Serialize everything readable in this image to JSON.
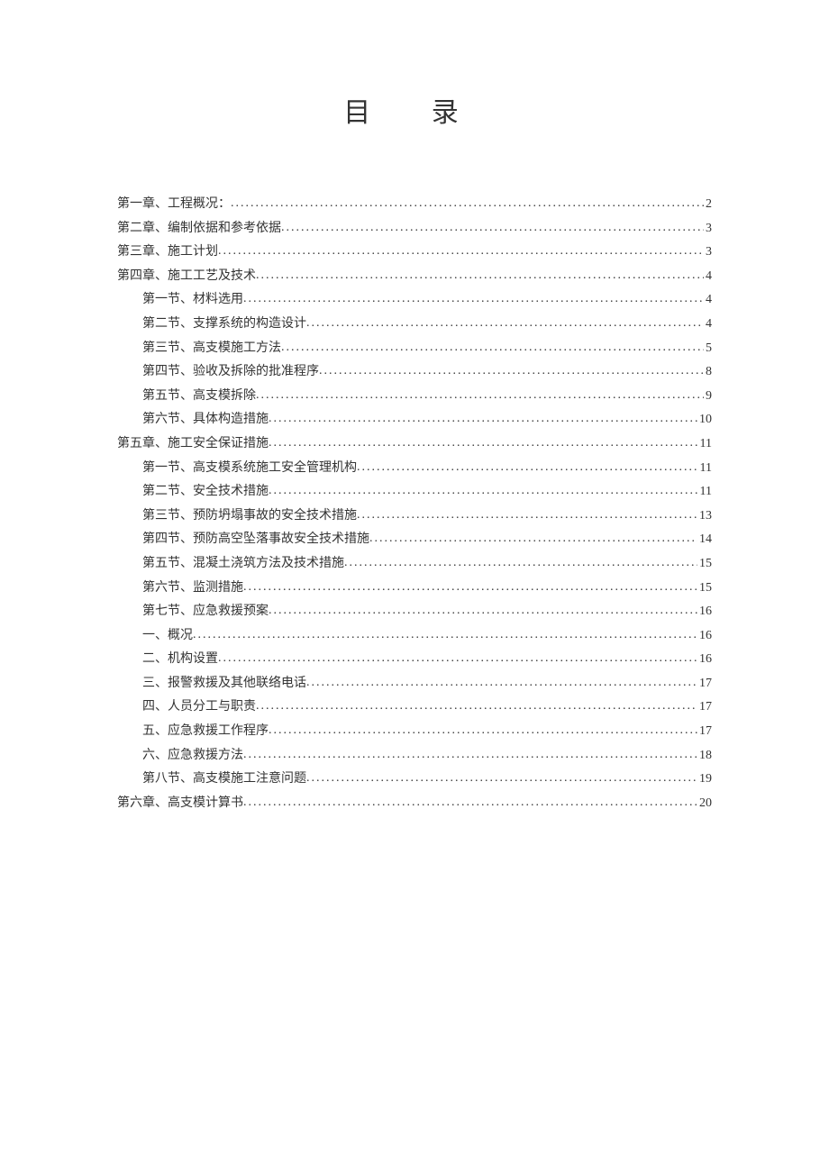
{
  "title": "目 录",
  "entries": [
    {
      "level": 1,
      "label": "第一章、工程概况：",
      "page": "2"
    },
    {
      "level": 1,
      "label": "第二章、编制依据和参考依据",
      "page": "3"
    },
    {
      "level": 1,
      "label": "第三章、施工计划",
      "page": "3"
    },
    {
      "level": 1,
      "label": "第四章、施工工艺及技术",
      "page": "4"
    },
    {
      "level": 2,
      "label": "第一节、材料选用",
      "page": "4"
    },
    {
      "level": 2,
      "label": "第二节、支撑系统的构造设计",
      "page": "4"
    },
    {
      "level": 2,
      "label": "第三节、高支模施工方法",
      "page": "5"
    },
    {
      "level": 2,
      "label": "第四节、验收及拆除的批准程序",
      "page": "8"
    },
    {
      "level": 2,
      "label": "第五节、高支模拆除",
      "page": "9"
    },
    {
      "level": 2,
      "label": "第六节、具体构造措施",
      "page": "10"
    },
    {
      "level": 1,
      "label": "第五章、施工安全保证措施",
      "page": "11"
    },
    {
      "level": 2,
      "label": "第一节、高支模系统施工安全管理机构",
      "page": "11"
    },
    {
      "level": 2,
      "label": "第二节、安全技术措施",
      "page": "11"
    },
    {
      "level": 2,
      "label": "第三节、预防坍塌事故的安全技术措施",
      "page": "13"
    },
    {
      "level": 2,
      "label": "第四节、预防高空坠落事故安全技术措施",
      "page": "14"
    },
    {
      "level": 2,
      "label": "第五节、混凝土浇筑方法及技术措施",
      "page": "15"
    },
    {
      "level": 2,
      "label": "第六节、监测措施",
      "page": "15"
    },
    {
      "level": 2,
      "label": "第七节、应急救援预案",
      "page": "16"
    },
    {
      "level": 3,
      "label": "一、概况",
      "page": "16"
    },
    {
      "level": 3,
      "label": "二、机构设置",
      "page": "16"
    },
    {
      "level": 3,
      "label": "三、报警救援及其他联络电话",
      "page": "17"
    },
    {
      "level": 3,
      "label": "四、人员分工与职责",
      "page": "17"
    },
    {
      "level": 3,
      "label": "五、应急救援工作程序",
      "page": "17"
    },
    {
      "level": 3,
      "label": "六、应急救援方法",
      "page": "18"
    },
    {
      "level": 2,
      "label": "第八节、高支模施工注意问题",
      "page": "19"
    },
    {
      "level": 1,
      "label": "第六章、高支模计算书",
      "page": "20"
    }
  ]
}
